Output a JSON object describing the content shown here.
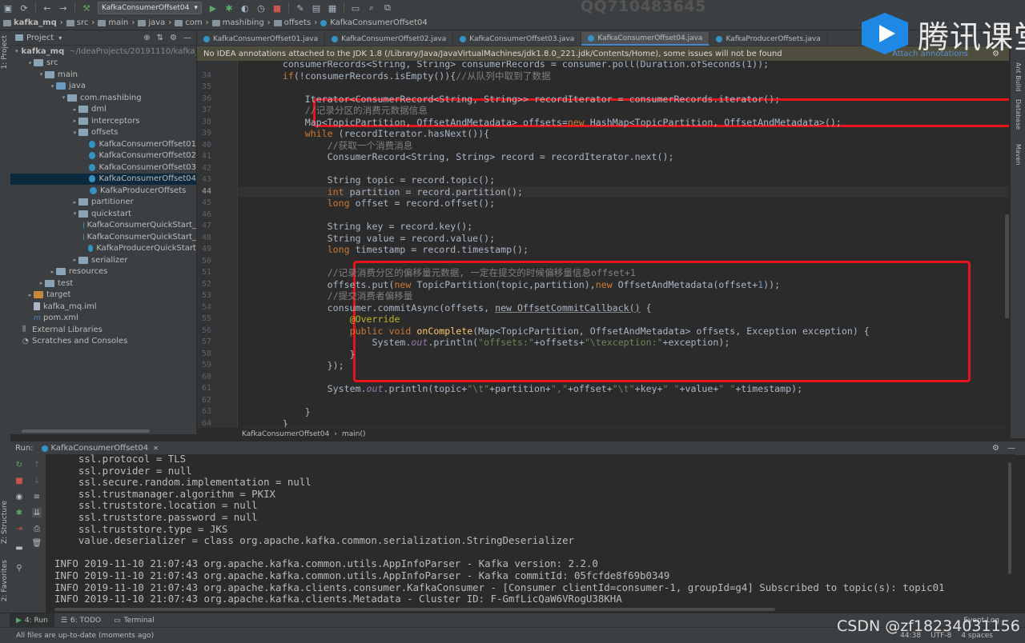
{
  "toolbar": {
    "project": "kafka_mq",
    "crumbs": [
      "src",
      "main",
      "java",
      "com",
      "mashibing",
      "offsets",
      "KafkaConsumerOffset04"
    ],
    "run_config": "KafkaConsumerOffset04"
  },
  "watermark_top": "QQ710483645",
  "logo_text": "腾讯课堂",
  "csdn_watermark": "CSDN @zf18234031156",
  "left_strip": {
    "project": "1: Project",
    "structure": "Z: Structure",
    "favorites": "2: Favorites"
  },
  "right_strip": {
    "ant": "Ant Build",
    "database": "Database",
    "maven": "Maven"
  },
  "project_panel": {
    "title": "Project",
    "items": [
      {
        "label": "kafka_mq",
        "extra": "~/IdeaProjects/20191110/kafka_mq",
        "depth": 0,
        "icon": "folder",
        "arrow": "▾",
        "bold": true
      },
      {
        "label": "src",
        "depth": 1,
        "icon": "folder",
        "arrow": "▾"
      },
      {
        "label": "main",
        "depth": 2,
        "icon": "folder",
        "arrow": "▾"
      },
      {
        "label": "java",
        "depth": 3,
        "icon": "folder-src",
        "arrow": "▾"
      },
      {
        "label": "com.mashibing",
        "depth": 4,
        "icon": "folder",
        "arrow": "▾"
      },
      {
        "label": "dml",
        "depth": 5,
        "icon": "folder",
        "arrow": "▸"
      },
      {
        "label": "interceptors",
        "depth": 5,
        "icon": "folder",
        "arrow": "▸"
      },
      {
        "label": "offsets",
        "depth": 5,
        "icon": "folder",
        "arrow": "▾"
      },
      {
        "label": "KafkaConsumerOffset01",
        "depth": 6,
        "icon": "class",
        "arrow": ""
      },
      {
        "label": "KafkaConsumerOffset02",
        "depth": 6,
        "icon": "class",
        "arrow": ""
      },
      {
        "label": "KafkaConsumerOffset03",
        "depth": 6,
        "icon": "class",
        "arrow": ""
      },
      {
        "label": "KafkaConsumerOffset04",
        "depth": 6,
        "icon": "class",
        "arrow": "",
        "selected": true
      },
      {
        "label": "KafkaProducerOffsets",
        "depth": 6,
        "icon": "class",
        "arrow": ""
      },
      {
        "label": "partitioner",
        "depth": 5,
        "icon": "folder",
        "arrow": "▸"
      },
      {
        "label": "quickstart",
        "depth": 5,
        "icon": "folder",
        "arrow": "▾"
      },
      {
        "label": "KafkaConsumerQuickStart_",
        "depth": 6,
        "icon": "class",
        "arrow": ""
      },
      {
        "label": "KafkaConsumerQuickStart_",
        "depth": 6,
        "icon": "class",
        "arrow": ""
      },
      {
        "label": "KafkaProducerQuickStart",
        "depth": 6,
        "icon": "class",
        "arrow": ""
      },
      {
        "label": "serializer",
        "depth": 5,
        "icon": "folder",
        "arrow": "▸"
      },
      {
        "label": "resources",
        "depth": 3,
        "icon": "folder",
        "arrow": "▸"
      },
      {
        "label": "test",
        "depth": 2,
        "icon": "folder",
        "arrow": "▸"
      },
      {
        "label": "target",
        "depth": 1,
        "icon": "folder-target",
        "arrow": "▸"
      },
      {
        "label": "kafka_mq.iml",
        "depth": 1,
        "icon": "file",
        "arrow": ""
      },
      {
        "label": "pom.xml",
        "depth": 1,
        "icon": "pom",
        "arrow": ""
      },
      {
        "label": "External Libraries",
        "depth": 0,
        "icon": "lib",
        "arrow": ""
      },
      {
        "label": "Scratches and Consoles",
        "depth": 0,
        "icon": "scratch",
        "arrow": ""
      }
    ]
  },
  "editor": {
    "tabs": [
      "KafkaConsumerOffset01.java",
      "KafkaConsumerOffset02.java",
      "KafkaConsumerOffset03.java",
      "KafkaConsumerOffset04.java",
      "KafkaProducerOffsets.java"
    ],
    "active_tab": 3,
    "notice": "No IDEA annotations attached to the JDK 1.8 (/Library/Java/JavaVirtualMachines/jdk1.8.0_221.jdk/Contents/Home), some issues will not be found",
    "notice_action": "Attach annotations",
    "current_line": 44,
    "breadcrumb": [
      "KafkaConsumerOffset04",
      "main()"
    ],
    "lines": [
      {
        "n": "",
        "segs": [
          [
            "        consumerRecords<String, String> consumerRecords = consumer.poll(Duration.ofSeconds(1));",
            "t"
          ]
        ]
      },
      {
        "n": "34",
        "segs": [
          [
            "        ",
            "t"
          ],
          [
            "if",
            "kw"
          ],
          [
            "(!consumerRecords.isEmpty()){",
            "t"
          ],
          [
            "//从队列中取到了数据",
            "cm"
          ]
        ]
      },
      {
        "n": "35",
        "segs": []
      },
      {
        "n": "36",
        "segs": [
          [
            "            Iterator<ConsumerRecord<String, String>> recordIterator = consumerRecords.iterator();",
            "t"
          ]
        ]
      },
      {
        "n": "37",
        "segs": [
          [
            "            ",
            "t"
          ],
          [
            "//记录分区的消费元数据信息",
            "cm"
          ]
        ]
      },
      {
        "n": "38",
        "segs": [
          [
            "            Map<TopicPartition, OffsetAndMetadata> offsets=",
            "t"
          ],
          [
            "new ",
            "kw"
          ],
          [
            "HashMap<TopicPartition, OffsetAndMetadata>();",
            "t"
          ]
        ]
      },
      {
        "n": "39",
        "segs": [
          [
            "            ",
            "t"
          ],
          [
            "while ",
            "kw"
          ],
          [
            "(recordIterator.hasNext()){",
            "t"
          ]
        ]
      },
      {
        "n": "40",
        "segs": [
          [
            "                ",
            "t"
          ],
          [
            "//获取一个消费消息",
            "cm"
          ]
        ]
      },
      {
        "n": "41",
        "segs": [
          [
            "                ConsumerRecord<String, String> ",
            "t"
          ],
          [
            "record",
            "t"
          ],
          [
            " = recordIterator.next();",
            "t"
          ]
        ]
      },
      {
        "n": "42",
        "segs": []
      },
      {
        "n": "43",
        "segs": [
          [
            "                String topic = ",
            "t"
          ],
          [
            "record",
            "t"
          ],
          [
            ".topic();",
            "t"
          ]
        ]
      },
      {
        "n": "44",
        "segs": [
          [
            "                ",
            "t"
          ],
          [
            "int ",
            "kw"
          ],
          [
            "partition = ",
            "t"
          ],
          [
            "record",
            "t"
          ],
          [
            ".partition();",
            "t"
          ]
        ]
      },
      {
        "n": "45",
        "segs": [
          [
            "                ",
            "t"
          ],
          [
            "long ",
            "kw"
          ],
          [
            "offset = ",
            "t"
          ],
          [
            "record",
            "t"
          ],
          [
            ".offset();",
            "t"
          ]
        ]
      },
      {
        "n": "46",
        "segs": []
      },
      {
        "n": "47",
        "segs": [
          [
            "                String key = ",
            "t"
          ],
          [
            "record",
            "t"
          ],
          [
            ".key();",
            "t"
          ]
        ]
      },
      {
        "n": "48",
        "segs": [
          [
            "                String value = ",
            "t"
          ],
          [
            "record",
            "t"
          ],
          [
            ".value();",
            "t"
          ]
        ]
      },
      {
        "n": "49",
        "segs": [
          [
            "                ",
            "t"
          ],
          [
            "long ",
            "kw"
          ],
          [
            "timestamp = ",
            "t"
          ],
          [
            "record",
            "t"
          ],
          [
            ".timestamp();",
            "t"
          ]
        ]
      },
      {
        "n": "50",
        "segs": []
      },
      {
        "n": "51",
        "segs": [
          [
            "                ",
            "t"
          ],
          [
            "//记录消费分区的偏移量元数据, 一定在提交的时候偏移量信息offset+1",
            "cm"
          ]
        ]
      },
      {
        "n": "52",
        "segs": [
          [
            "                offsets.put(",
            "t"
          ],
          [
            "new ",
            "kw"
          ],
          [
            "TopicPartition(topic,partition),",
            "t"
          ],
          [
            "new ",
            "kw"
          ],
          [
            "OffsetAndMetadata(offset+",
            "t"
          ],
          [
            "1",
            "nm"
          ],
          [
            "));",
            "t"
          ]
        ]
      },
      {
        "n": "53",
        "segs": [
          [
            "                ",
            "t"
          ],
          [
            "//提交消费者偏移量",
            "cm"
          ]
        ]
      },
      {
        "n": "54",
        "segs": [
          [
            "                consumer.commitAsync(offsets, ",
            "t"
          ],
          [
            "new OffsetCommitCallback()",
            "und"
          ],
          [
            " {",
            "t"
          ]
        ]
      },
      {
        "n": "55",
        "segs": [
          [
            "                    ",
            "t"
          ],
          [
            "@Override",
            "an"
          ]
        ]
      },
      {
        "n": "56",
        "segs": [
          [
            "                    ",
            "t"
          ],
          [
            "public void ",
            "kw"
          ],
          [
            "onComplete",
            "fn"
          ],
          [
            "(Map<TopicPartition, OffsetAndMetadata> offsets, Exception exception) {",
            "t"
          ]
        ]
      },
      {
        "n": "57",
        "segs": [
          [
            "                        System.",
            "t"
          ],
          [
            "out",
            "fld"
          ],
          [
            ".println(",
            "t"
          ],
          [
            "\"offsets:\"",
            "st"
          ],
          [
            "+offsets+",
            "t"
          ],
          [
            "\"\\texception:\"",
            "st"
          ],
          [
            "+exception);",
            "t"
          ]
        ]
      },
      {
        "n": "58",
        "segs": [
          [
            "                    }",
            "t"
          ]
        ]
      },
      {
        "n": "59",
        "segs": [
          [
            "                });",
            "t"
          ]
        ]
      },
      {
        "n": "60",
        "segs": []
      },
      {
        "n": "61",
        "segs": [
          [
            "                System.",
            "t"
          ],
          [
            "out",
            "fld"
          ],
          [
            ".println(topic+",
            "t"
          ],
          [
            "\"\\t\"",
            "st"
          ],
          [
            "+partition+",
            "t"
          ],
          [
            "\",\"",
            "st"
          ],
          [
            "+offset+",
            "t"
          ],
          [
            "\"\\t\"",
            "st"
          ],
          [
            "+key+",
            "t"
          ],
          [
            "\" \"",
            "st"
          ],
          [
            "+value+",
            "t"
          ],
          [
            "\" \"",
            "st"
          ],
          [
            "+timestamp);",
            "t"
          ]
        ]
      },
      {
        "n": "62",
        "segs": []
      },
      {
        "n": "63",
        "segs": [
          [
            "            }",
            "t"
          ]
        ]
      },
      {
        "n": "64",
        "segs": [
          [
            "        }",
            "t"
          ]
        ]
      }
    ]
  },
  "run_panel": {
    "label": "Run:",
    "tab": "KafkaConsumerOffset04",
    "lines": [
      "    ssl.protocol = TLS",
      "    ssl.provider = null",
      "    ssl.secure.random.implementation = null",
      "    ssl.trustmanager.algorithm = PKIX",
      "    ssl.truststore.location = null",
      "    ssl.truststore.password = null",
      "    ssl.truststore.type = JKS",
      "    value.deserializer = class org.apache.kafka.common.serialization.StringDeserializer",
      "",
      "INFO 2019-11-10 21:07:43 org.apache.kafka.common.utils.AppInfoParser - Kafka version: 2.2.0",
      "INFO 2019-11-10 21:07:43 org.apache.kafka.common.utils.AppInfoParser - Kafka commitId: 05fcfde8f69b0349",
      "INFO 2019-11-10 21:07:43 org.apache.kafka.clients.consumer.KafkaConsumer - [Consumer clientId=consumer-1, groupId=g4] Subscribed to topic(s): topic01",
      "INFO 2019-11-10 21:07:43 org.apache.kafka.clients.Metadata - Cluster ID: F-GmfLicQaW6VRogU38KHA"
    ]
  },
  "bottom_tabs": {
    "run": "4: Run",
    "todo": "6: TODO",
    "terminal": "Terminal",
    "event_log": "Event Log"
  },
  "status": {
    "message": "All files are up-to-date (moments ago)",
    "position": "44:38",
    "encoding": "UTF-8",
    "indent": "4 spaces"
  },
  "colors": {
    "accent": "#4a88c7",
    "highlight_box": "#e8141b",
    "selection": "#0d293e"
  }
}
